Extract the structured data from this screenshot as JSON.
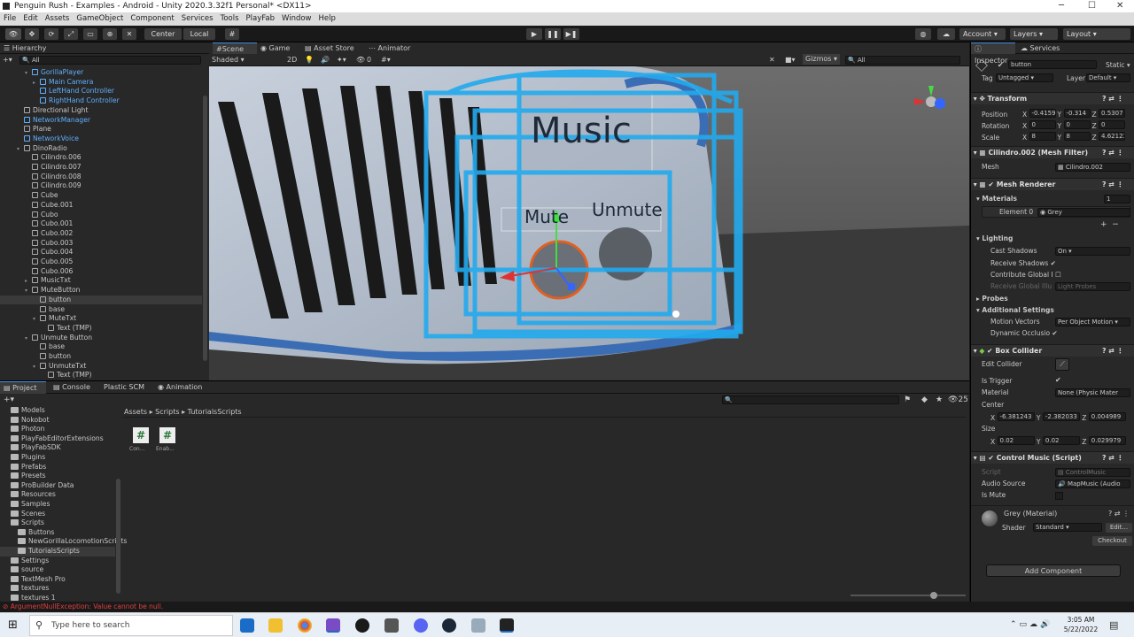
{
  "window": {
    "title": "Penguin Rush - Examples - Android - Unity 2020.3.32f1 Personal* <DX11>"
  },
  "menu": [
    "File",
    "Edit",
    "Assets",
    "GameObject",
    "Component",
    "Services",
    "Tools",
    "PlayFab",
    "Window",
    "Help"
  ],
  "toolbar": {
    "center": "Center",
    "local": "Local",
    "account": "Account",
    "layers": "Layers",
    "layout": "Layout"
  },
  "hierarchy": {
    "title": "Hierarchy",
    "search": "All",
    "items": [
      {
        "label": "GorillaPlayer",
        "indent": 2,
        "blue": true,
        "arrow": "▾"
      },
      {
        "label": "Main Camera",
        "indent": 3,
        "blue": true,
        "arrow": "▸"
      },
      {
        "label": "LeftHand Controller",
        "indent": 3,
        "blue": true,
        "arrow": ""
      },
      {
        "label": "RightHand Controller",
        "indent": 3,
        "blue": true,
        "arrow": ""
      },
      {
        "label": "Directional Light",
        "indent": 1,
        "blue": false,
        "arrow": ""
      },
      {
        "label": "NetworkManager",
        "indent": 1,
        "blue": true,
        "arrow": ""
      },
      {
        "label": "Plane",
        "indent": 1,
        "blue": false,
        "arrow": ""
      },
      {
        "label": "NetworkVoice",
        "indent": 1,
        "blue": true,
        "arrow": ""
      },
      {
        "label": "DinoRadio",
        "indent": 1,
        "blue": false,
        "arrow": "▾"
      },
      {
        "label": "Cilindro.006",
        "indent": 2,
        "blue": false,
        "arrow": ""
      },
      {
        "label": "Cilindro.007",
        "indent": 2,
        "blue": false,
        "arrow": ""
      },
      {
        "label": "Cilindro.008",
        "indent": 2,
        "blue": false,
        "arrow": ""
      },
      {
        "label": "Cilindro.009",
        "indent": 2,
        "blue": false,
        "arrow": ""
      },
      {
        "label": "Cube",
        "indent": 2,
        "blue": false,
        "arrow": ""
      },
      {
        "label": "Cube.001",
        "indent": 2,
        "blue": false,
        "arrow": ""
      },
      {
        "label": "Cubo",
        "indent": 2,
        "blue": false,
        "arrow": ""
      },
      {
        "label": "Cubo.001",
        "indent": 2,
        "blue": false,
        "arrow": ""
      },
      {
        "label": "Cubo.002",
        "indent": 2,
        "blue": false,
        "arrow": ""
      },
      {
        "label": "Cubo.003",
        "indent": 2,
        "blue": false,
        "arrow": ""
      },
      {
        "label": "Cubo.004",
        "indent": 2,
        "blue": false,
        "arrow": ""
      },
      {
        "label": "Cubo.005",
        "indent": 2,
        "blue": false,
        "arrow": ""
      },
      {
        "label": "Cubo.006",
        "indent": 2,
        "blue": false,
        "arrow": ""
      },
      {
        "label": "MusicTxt",
        "indent": 2,
        "blue": false,
        "arrow": "▸"
      },
      {
        "label": "MuteButton",
        "indent": 2,
        "blue": false,
        "arrow": "▾"
      },
      {
        "label": "button",
        "indent": 3,
        "blue": false,
        "arrow": "",
        "selected": true
      },
      {
        "label": "base",
        "indent": 3,
        "blue": false,
        "arrow": ""
      },
      {
        "label": "MuteTxt",
        "indent": 3,
        "blue": false,
        "arrow": "▾"
      },
      {
        "label": "Text (TMP)",
        "indent": 4,
        "blue": false,
        "arrow": ""
      },
      {
        "label": "Unmute Button",
        "indent": 2,
        "blue": false,
        "arrow": "▾"
      },
      {
        "label": "base",
        "indent": 3,
        "blue": false,
        "arrow": ""
      },
      {
        "label": "button",
        "indent": 3,
        "blue": false,
        "arrow": ""
      },
      {
        "label": "UnmuteTxt",
        "indent": 3,
        "blue": false,
        "arrow": "▾"
      },
      {
        "label": "Text (TMP)",
        "indent": 4,
        "blue": false,
        "arrow": ""
      }
    ]
  },
  "scene": {
    "tabs": [
      "Scene",
      "Game",
      "Asset Store",
      "Animator"
    ],
    "shading": "Shaded",
    "mode2d": "2D",
    "gizmos": "Gizmos",
    "search": "All",
    "layer_count": "0",
    "music_label": "Music",
    "mute_label": "Mute",
    "unmute_label": "Unmute"
  },
  "project": {
    "tabs": [
      "Project",
      "Console",
      "Plastic SCM",
      "Animation"
    ],
    "count": "25",
    "breadcrumb": [
      "Assets",
      "Scripts",
      "TutorialsScripts"
    ],
    "folders": [
      {
        "label": "Models",
        "indent": 1
      },
      {
        "label": "Nokobot",
        "indent": 1
      },
      {
        "label": "Photon",
        "indent": 1
      },
      {
        "label": "PlayFabEditorExtensions",
        "indent": 1
      },
      {
        "label": "PlayFabSDK",
        "indent": 1
      },
      {
        "label": "Plugins",
        "indent": 1
      },
      {
        "label": "Prefabs",
        "indent": 1
      },
      {
        "label": "Presets",
        "indent": 1
      },
      {
        "label": "ProBuilder Data",
        "indent": 1
      },
      {
        "label": "Resources",
        "indent": 1
      },
      {
        "label": "Samples",
        "indent": 1
      },
      {
        "label": "Scenes",
        "indent": 1
      },
      {
        "label": "Scripts",
        "indent": 1
      },
      {
        "label": "Buttons",
        "indent": 2
      },
      {
        "label": "NewGorillaLocomotionScripts",
        "indent": 2
      },
      {
        "label": "TutorialsScripts",
        "indent": 2,
        "selected": true
      },
      {
        "label": "Settings",
        "indent": 1
      },
      {
        "label": "source",
        "indent": 1
      },
      {
        "label": "TextMesh Pro",
        "indent": 1
      },
      {
        "label": "textures",
        "indent": 1
      },
      {
        "label": "textures 1",
        "indent": 1
      }
    ],
    "files": [
      {
        "label": "Con..."
      },
      {
        "label": "Enab..."
      }
    ]
  },
  "inspector": {
    "tabs": [
      "Inspector",
      "Services"
    ],
    "object_name": "button",
    "static": "Static",
    "tag_label": "Tag",
    "tag": "Untagged",
    "layer_label": "Layer",
    "layer": "Default",
    "transform": {
      "title": "Transform",
      "rows": [
        {
          "label": "Position",
          "x": "-0.4159",
          "y": "-0.314",
          "z": "0.5307"
        },
        {
          "label": "Rotation",
          "x": "0",
          "y": "0",
          "z": "0"
        },
        {
          "label": "Scale",
          "x": "8",
          "y": "8",
          "z": "4.62123"
        }
      ]
    },
    "mesh_filter": {
      "title": "Cilindro.002 (Mesh Filter)",
      "mesh_label": "Mesh",
      "mesh": "Cilindro.002"
    },
    "mesh_renderer": {
      "title": "Mesh Renderer",
      "materials": "Materials",
      "materials_count": "1",
      "element": "Element 0",
      "element_value": "Grey",
      "lighting": "Lighting",
      "cast_shadows_label": "Cast Shadows",
      "cast_shadows": "On",
      "receive_shadows": "Receive Shadows",
      "contribute_gi": "Contribute Global I",
      "receive_gi": "Receive Global Illu",
      "receive_gi_value": "Light Probes",
      "probes": "Probes",
      "additional": "Additional Settings",
      "motion_vectors": "Motion Vectors",
      "motion_vectors_value": "Per Object Motion",
      "dynamic_occlusion": "Dynamic Occlusio"
    },
    "box_collider": {
      "title": "Box Collider",
      "edit_collider": "Edit Collider",
      "is_trigger": "Is Trigger",
      "material_label": "Material",
      "material": "None (Physic Mater",
      "center": "Center",
      "cx": "-6.381243",
      "cy": "-2.382033",
      "cz": "0.004989",
      "size": "Size",
      "sx": "0.02",
      "sy": "0.02",
      "sz": "0.029979"
    },
    "control_music": {
      "title": "Control Music (Script)",
      "script_label": "Script",
      "script": "ControlMusic",
      "audio_label": "Audio Source",
      "audio": "MapMusic (Audio",
      "is_mute": "Is Mute"
    },
    "material": {
      "title": "Grey (Material)",
      "shader_label": "Shader",
      "shader": "Standard",
      "edit": "Edit...",
      "checkout": "Checkout"
    },
    "add_component": "Add Component"
  },
  "status": {
    "error": "ArgumentNullException: Value cannot be null."
  },
  "taskbar": {
    "search": "Type here to search",
    "time": "3:05 AM",
    "date": "5/22/2022"
  }
}
